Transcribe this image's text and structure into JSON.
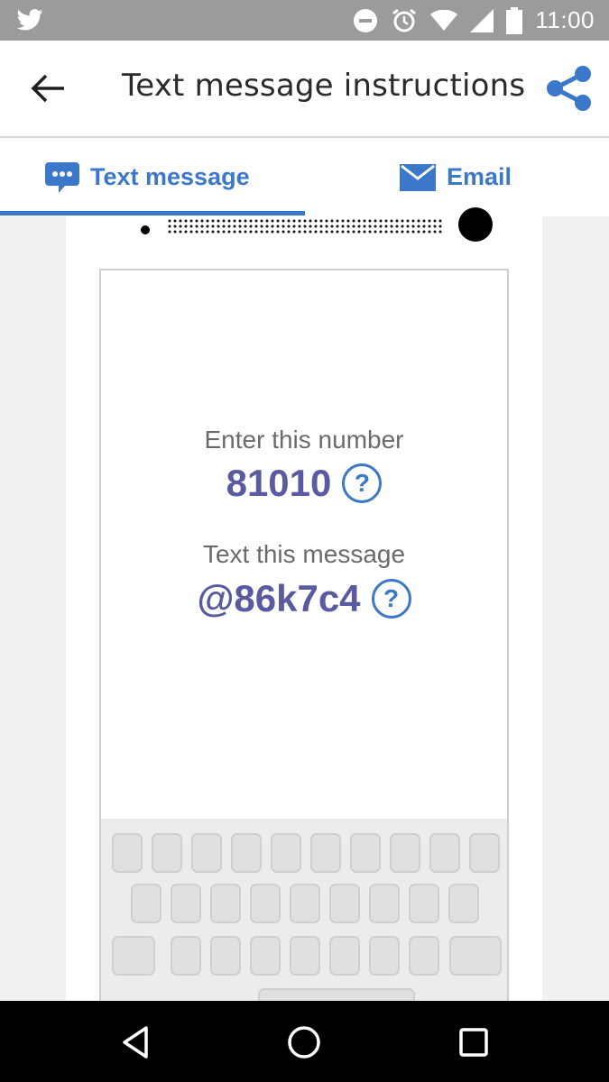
{
  "status_bar": {
    "time": "11:00",
    "icons": [
      "twitter-icon",
      "do-not-disturb-icon",
      "alarm-icon",
      "wifi-icon",
      "signal-icon",
      "battery-icon"
    ]
  },
  "appbar": {
    "title": "Text message instructions",
    "back_icon": "arrow-left-icon",
    "share_icon": "share-icon",
    "accent_color": "#3b78c9"
  },
  "tabs": [
    {
      "label": "Text message",
      "icon": "chat-bubble-icon",
      "selected": true
    },
    {
      "label": "Email",
      "icon": "envelope-icon",
      "selected": false
    }
  ],
  "instructions": {
    "number_label": "Enter this number",
    "number_value": "81010",
    "message_label": "Text this message",
    "message_value": "@86k7c4",
    "help_glyph": "?"
  },
  "nav_bar": {
    "icons": [
      "back-triangle-icon",
      "home-circle-icon",
      "recents-square-icon"
    ]
  }
}
